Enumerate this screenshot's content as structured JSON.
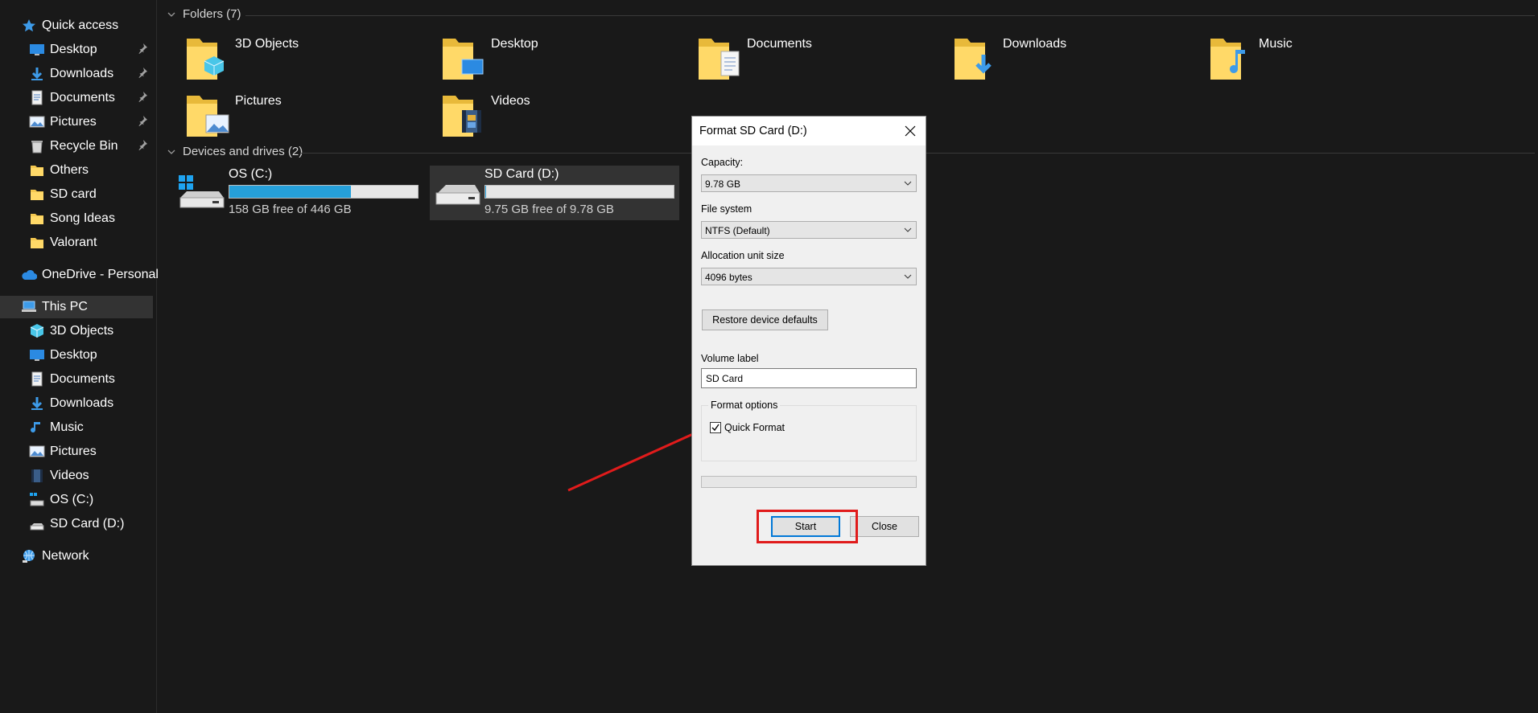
{
  "sidebar": {
    "quick_access": "Quick access",
    "quick_items": [
      {
        "label": "Desktop",
        "icon": "desktop-icon",
        "pinned": true
      },
      {
        "label": "Downloads",
        "icon": "downloads-icon",
        "pinned": true
      },
      {
        "label": "Documents",
        "icon": "documents-icon",
        "pinned": true
      },
      {
        "label": "Pictures",
        "icon": "pictures-icon",
        "pinned": true
      },
      {
        "label": "Recycle Bin",
        "icon": "recycle-bin-icon",
        "pinned": true
      },
      {
        "label": "Others",
        "icon": "folder-icon",
        "pinned": false
      },
      {
        "label": "SD card",
        "icon": "folder-icon",
        "pinned": false
      },
      {
        "label": "Song Ideas",
        "icon": "folder-icon",
        "pinned": false
      },
      {
        "label": "Valorant",
        "icon": "folder-icon",
        "pinned": false
      }
    ],
    "onedrive": "OneDrive - Personal",
    "this_pc": "This PC",
    "pc_items": [
      {
        "label": "3D Objects",
        "icon": "3d-objects-icon"
      },
      {
        "label": "Desktop",
        "icon": "desktop-icon"
      },
      {
        "label": "Documents",
        "icon": "documents-icon"
      },
      {
        "label": "Downloads",
        "icon": "downloads-icon"
      },
      {
        "label": "Music",
        "icon": "music-icon"
      },
      {
        "label": "Pictures",
        "icon": "pictures-icon"
      },
      {
        "label": "Videos",
        "icon": "videos-icon"
      },
      {
        "label": "OS (C:)",
        "icon": "os-drive-icon"
      },
      {
        "label": "SD Card (D:)",
        "icon": "sd-drive-icon"
      }
    ],
    "network": "Network"
  },
  "main": {
    "folders_header": "Folders (7)",
    "folders": [
      {
        "label": "3D Objects",
        "icon": "3d-objects-folder-icon"
      },
      {
        "label": "Desktop",
        "icon": "desktop-folder-icon"
      },
      {
        "label": "Documents",
        "icon": "documents-folder-icon"
      },
      {
        "label": "Downloads",
        "icon": "downloads-folder-icon"
      },
      {
        "label": "Music",
        "icon": "music-folder-icon"
      },
      {
        "label": "Pictures",
        "icon": "pictures-folder-icon"
      },
      {
        "label": "Videos",
        "icon": "videos-folder-icon"
      }
    ],
    "drives_header": "Devices and drives (2)",
    "drives": [
      {
        "name": "OS (C:)",
        "free": "158 GB free of 446 GB",
        "used_fraction": 0.646
      },
      {
        "name": "SD Card (D:)",
        "free": "9.75 GB free of 9.78 GB",
        "used_fraction": 0.003
      }
    ]
  },
  "dialog": {
    "title": "Format SD Card (D:)",
    "capacity_label": "Capacity:",
    "capacity_value": "9.78 GB",
    "filesystem_label": "File system",
    "filesystem_value": "NTFS (Default)",
    "allocation_label": "Allocation unit size",
    "allocation_value": "4096 bytes",
    "restore_button": "Restore device defaults",
    "volume_label": "Volume label",
    "volume_value": "SD Card",
    "format_options": "Format options",
    "quick_format_label": "Quick Format",
    "quick_format_checked": true,
    "start_button": "Start",
    "close_button": "Close"
  },
  "colors": {
    "background": "#191919",
    "accent": "#26a0da",
    "annotation": "#e01b1b"
  }
}
